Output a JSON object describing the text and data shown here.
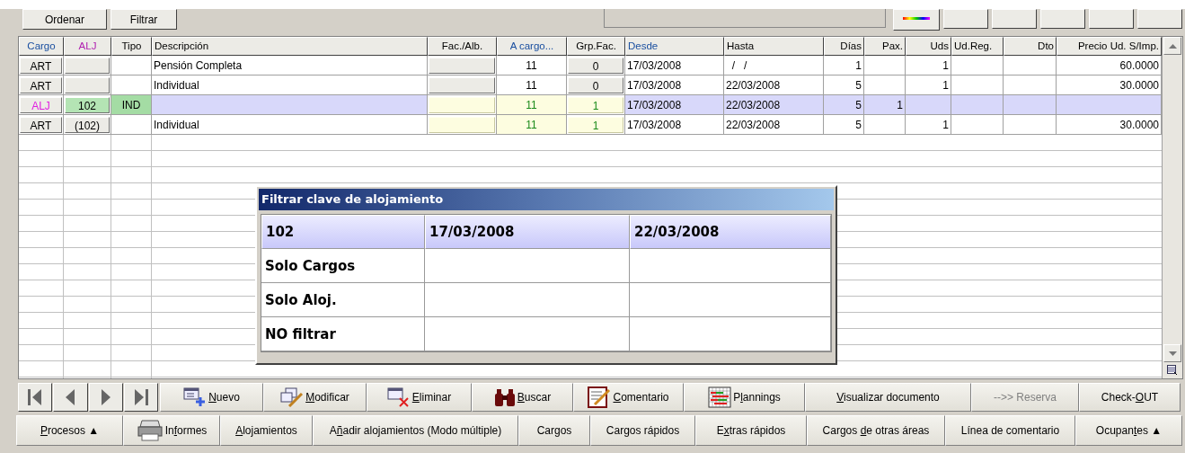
{
  "toolbar": {
    "buttons": [
      "Ordenar",
      "Filtrar"
    ]
  },
  "table": {
    "columns": [
      {
        "label": "Cargo",
        "color": "#1a4fa0"
      },
      {
        "label": "ALJ",
        "color": "#b020b0"
      },
      {
        "label": "Tipo"
      },
      {
        "label": "Descripción"
      },
      {
        "label": "Fac./Alb."
      },
      {
        "label": "A cargo...",
        "color": "#1a4fa0"
      },
      {
        "label": "Grp.Fac."
      },
      {
        "label": "Desde",
        "color": "#1a4fa0"
      },
      {
        "label": "Hasta"
      },
      {
        "label": "Días"
      },
      {
        "label": "Pax."
      },
      {
        "label": "Uds"
      },
      {
        "label": "Ud.Reg."
      },
      {
        "label": "Dto"
      },
      {
        "label": "Precio Ud. S/Imp."
      }
    ],
    "rows": [
      {
        "kind": "art",
        "selected": false,
        "linked": false,
        "cells": [
          "ART",
          null,
          null,
          "Pensión Completa",
          null,
          "11",
          "0",
          "17/03/2008",
          "  /   /",
          "1",
          null,
          "1",
          null,
          null,
          "60.0000"
        ]
      },
      {
        "kind": "art",
        "selected": false,
        "linked": false,
        "cells": [
          "ART",
          null,
          null,
          "Individual",
          null,
          "11",
          "0",
          "17/03/2008",
          "22/03/2008",
          "5",
          null,
          "1",
          null,
          null,
          "30.0000"
        ]
      },
      {
        "kind": "alj",
        "selected": true,
        "linked": true,
        "cells": [
          "ALJ",
          "102",
          "IND",
          null,
          null,
          "11",
          "1",
          "17/03/2008",
          "22/03/2008",
          "5",
          "1",
          null,
          null,
          null,
          null
        ]
      },
      {
        "kind": "art",
        "selected": false,
        "linked": true,
        "cells": [
          "ART",
          "(102)",
          null,
          "Individual",
          null,
          "11",
          "1",
          "17/03/2008",
          "22/03/2008",
          "5",
          null,
          "1",
          null,
          null,
          "30.0000"
        ]
      }
    ]
  },
  "popup": {
    "title": "Filtrar clave de alojamiento",
    "rows": [
      {
        "selected": true,
        "cells": [
          "102",
          "17/03/2008",
          "22/03/2008"
        ]
      },
      {
        "selected": false,
        "cells": [
          "Solo Cargos"
        ]
      },
      {
        "selected": false,
        "cells": [
          "Solo Aloj."
        ]
      },
      {
        "selected": false,
        "cells": [
          "NO filtrar"
        ]
      }
    ]
  },
  "action_bar": [
    {
      "kind": "new",
      "accel": "N",
      "after": "uevo",
      "disabled": false
    },
    {
      "kind": "edit",
      "accel": "M",
      "after": "odificar",
      "disabled": false
    },
    {
      "kind": "delete",
      "accel": "E",
      "after": "liminar",
      "disabled": false
    },
    {
      "kind": "search",
      "accel": "B",
      "after": "uscar",
      "disabled": false
    },
    {
      "kind": "comment",
      "accel": "C",
      "after": "omentario",
      "disabled": false
    },
    {
      "kind": "planning",
      "before": "P",
      "accel": "l",
      "after": "annings",
      "disabled": false
    },
    {
      "accel": "V",
      "after": "isualizar documento",
      "disabled": false
    },
    {
      "before": "-->> Reserva",
      "disabled": true
    },
    {
      "before": "Check-",
      "accel": "O",
      "after": "UT",
      "disabled": false
    }
  ],
  "menu_bar": [
    {
      "accel": "P",
      "after": "rocesos ▲"
    },
    {
      "kind": "print",
      "before": "In",
      "accel": "f",
      "after": "ormes"
    },
    {
      "accel": "A",
      "after": "lojamientos"
    },
    {
      "before": "A",
      "accel": "ñ",
      "after": "adir alojamientos (Modo múltiple)"
    },
    {
      "before": "Cargos"
    },
    {
      "before": "Cargos rápidos"
    },
    {
      "before": "E",
      "accel": "x",
      "after": "tras rápidos"
    },
    {
      "before": "Cargos ",
      "accel": "d",
      "after": "e otras áreas"
    },
    {
      "before": "Línea de comentario"
    },
    {
      "before": "Ocupan",
      "accel": "t",
      "after": "es ▲"
    }
  ]
}
